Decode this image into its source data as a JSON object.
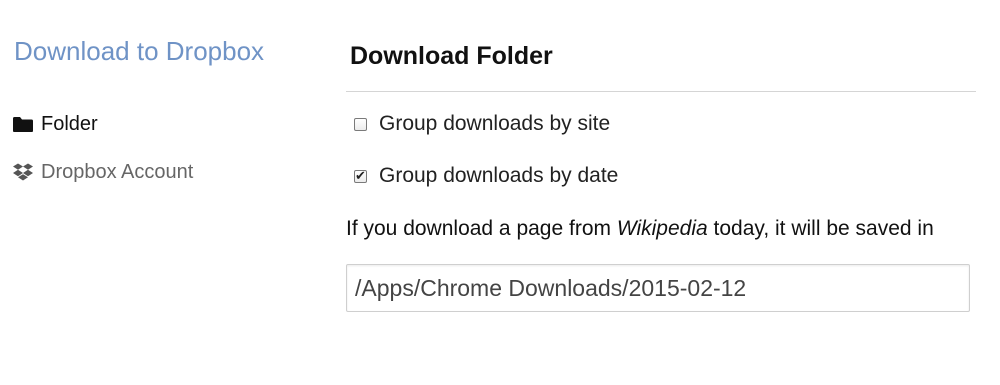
{
  "sidebar": {
    "title": "Download to Dropbox",
    "items": [
      {
        "label": "Folder",
        "icon": "folder-icon",
        "active": true
      },
      {
        "label": "Dropbox Account",
        "icon": "dropbox-icon",
        "active": false
      }
    ]
  },
  "main": {
    "section_title": "Download Folder",
    "options": [
      {
        "label": "Group downloads by site",
        "checked": false
      },
      {
        "label": "Group downloads by date",
        "checked": true
      }
    ],
    "info": {
      "prefix": "If you download a page from ",
      "site": "Wikipedia",
      "suffix": " today, it will be saved in"
    },
    "path_value": "/Apps/Chrome Downloads/2015-02-12"
  },
  "colors": {
    "title_accent": "#6f93c6",
    "text_dark": "#111111",
    "text_muted": "#666666"
  }
}
